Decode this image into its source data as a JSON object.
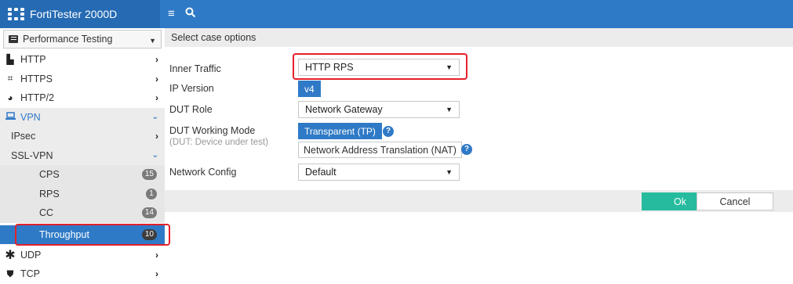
{
  "app": {
    "title": "FortiTester 2000D"
  },
  "topbar": {
    "menu_icon": "hamburger-icon",
    "search_icon": "search-icon"
  },
  "sidebar": {
    "profile_selector": {
      "value": "Performance Testing"
    },
    "items": [
      {
        "label": "HTTP",
        "icon": "building-icon"
      },
      {
        "label": "HTTPS",
        "icon": "lock-grid-icon"
      },
      {
        "label": "HTTP/2",
        "icon": "globe-icon"
      },
      {
        "label": "VPN",
        "icon": "laptop-icon"
      },
      {
        "label": "IPsec"
      },
      {
        "label": "SSL-VPN"
      },
      {
        "label": "CPS",
        "badge": "15"
      },
      {
        "label": "RPS",
        "badge": "1"
      },
      {
        "label": "CC",
        "badge": "14"
      },
      {
        "label": "Throughput",
        "badge": "10"
      },
      {
        "label": "UDP",
        "icon": "asterisk-icon"
      },
      {
        "label": "TCP",
        "icon": "shield-icon"
      }
    ]
  },
  "main": {
    "section_title": "Select case options",
    "inner_traffic": {
      "label": "Inner Traffic",
      "value": "HTTP RPS"
    },
    "ip_version": {
      "label": "IP Version",
      "value": "v4"
    },
    "dut_role": {
      "label": "DUT Role",
      "value": "Network Gateway"
    },
    "dut_mode": {
      "label": "DUT Working Mode",
      "hint": "(DUT: Device under test)",
      "option_selected": "Transparent (TP)",
      "option_other": "Network Address Translation (NAT)"
    },
    "network_config": {
      "label": "Network Config",
      "value": "Default"
    },
    "buttons": {
      "ok": "Ok",
      "cancel": "Cancel"
    }
  },
  "colors": {
    "brand": "#2f7ac6",
    "ok": "#26bb9e",
    "highlight": "#e5202a"
  }
}
